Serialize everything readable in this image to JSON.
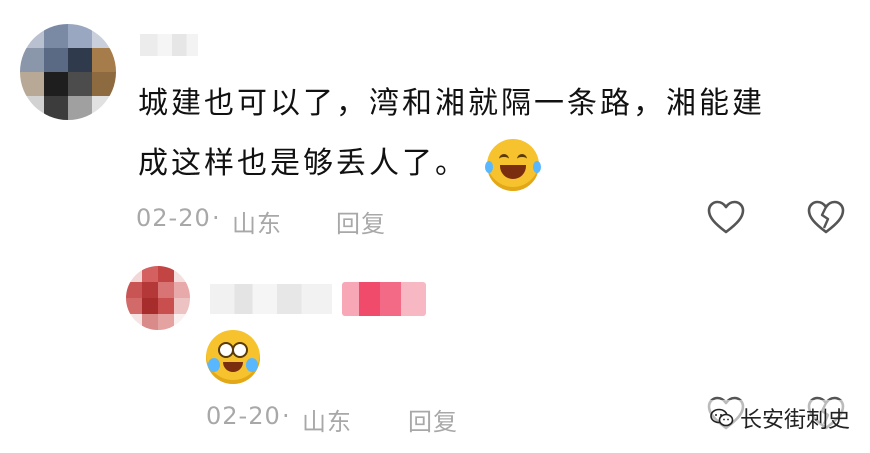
{
  "comment": {
    "text_line1": "城建也可以了，湾和湘就隔一条路，湘能建",
    "text_line2": "成这样也是够丢人了。",
    "emoji_icon": "rolling-laughing-emoji",
    "date": "02-20",
    "dot": "·",
    "location": "山东",
    "reply_label": "回复"
  },
  "reply": {
    "emoji_icon": "crying-laughing-emoji",
    "date": "02-20",
    "dot": "·",
    "location": "山东",
    "reply_label": "回复"
  },
  "watermark": {
    "text": "长安街刺史",
    "icon": "wechat-icon"
  },
  "colors": {
    "meta_gray": "#a8a8a8",
    "icon_gray": "#555555",
    "tag_pink": "#f04b6b"
  }
}
